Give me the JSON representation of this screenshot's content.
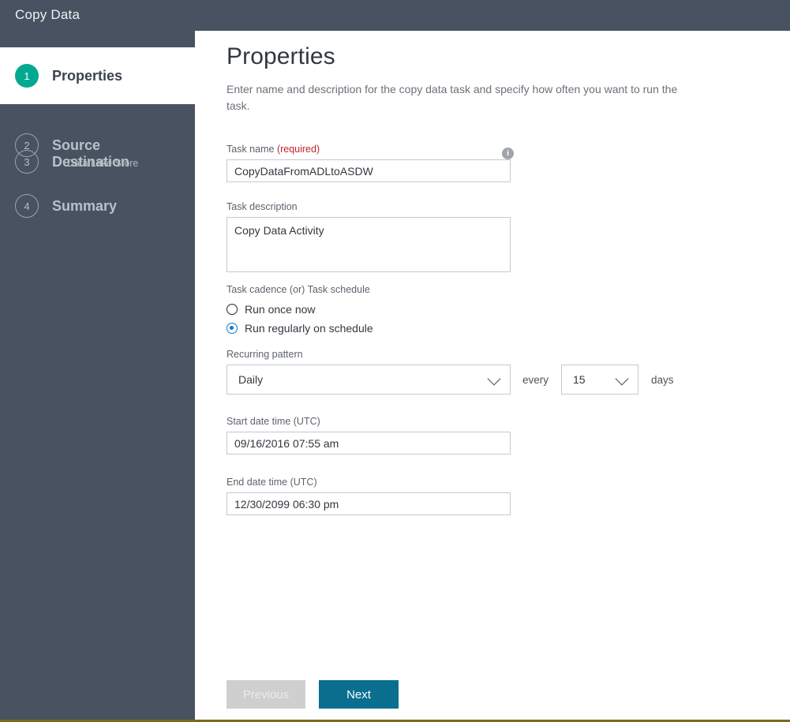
{
  "window": {
    "title": "Copy Data"
  },
  "sidebar": {
    "steps": [
      {
        "number": "1",
        "label": "Properties",
        "sub": "",
        "active": true
      },
      {
        "number": "2",
        "label": "Source",
        "sub": "Data Lake Store",
        "active": false
      },
      {
        "number": "3",
        "label": "Destination",
        "sub": "",
        "active": false
      },
      {
        "number": "4",
        "label": "Summary",
        "sub": "",
        "active": false
      }
    ]
  },
  "main": {
    "title": "Properties",
    "description": "Enter name and description for the copy data task and specify how often you want to run the task.",
    "task_name": {
      "label": "Task name",
      "required_text": "(required)",
      "value": "CopyDataFromADLtoASDW",
      "info_icon": "info-icon",
      "info_glyph": "i"
    },
    "task_description": {
      "label": "Task description",
      "value": "Copy Data Activity"
    },
    "cadence": {
      "label": "Task cadence (or) Task schedule",
      "options": [
        {
          "label": "Run once now",
          "selected": false
        },
        {
          "label": "Run regularly on schedule",
          "selected": true
        }
      ]
    },
    "recurrence": {
      "label": "Recurring pattern",
      "pattern_value": "Daily",
      "every_word": "every",
      "interval_value": "15",
      "unit_word": "days",
      "chevron_icon": "chevron-down-icon"
    },
    "start_date": {
      "label": "Start date time (UTC)",
      "value": "09/16/2016 07:55 am"
    },
    "end_date": {
      "label": "End date time (UTC)",
      "value": "12/30/2099 06:30 pm"
    }
  },
  "footer": {
    "previous_label": "Previous",
    "next_label": "Next"
  },
  "colors": {
    "sidebar_bg": "#495261",
    "active_badge": "#00a98f",
    "primary_button": "#0a6e8f",
    "required_text": "#c4262e",
    "radio_selected": "#0a7ac4"
  }
}
